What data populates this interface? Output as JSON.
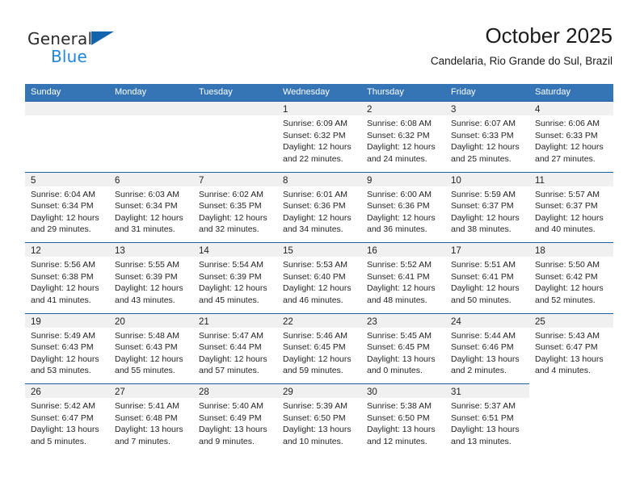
{
  "brand": {
    "name_part1": "General",
    "name_part2": "Blue",
    "triangle_icon": "triangle-icon",
    "accent_color": "#1264ac",
    "blue_text_color": "#2288dd"
  },
  "header": {
    "title": "October 2025",
    "subtitle": "Candelaria, Rio Grande do Sul, Brazil"
  },
  "theme": {
    "header_row_bg": "#3575b5",
    "cell_border": "#1f5fa0",
    "daynum_band_bg": "#f0f0f0"
  },
  "weekdays": [
    "Sunday",
    "Monday",
    "Tuesday",
    "Wednesday",
    "Thursday",
    "Friday",
    "Saturday"
  ],
  "weeks": [
    [
      {
        "blank": true
      },
      {
        "blank": true
      },
      {
        "blank": true
      },
      {
        "day": "1",
        "sunrise": "Sunrise: 6:09 AM",
        "sunset": "Sunset: 6:32 PM",
        "daylight_line1": "Daylight: 12 hours",
        "daylight_line2": "and 22 minutes."
      },
      {
        "day": "2",
        "sunrise": "Sunrise: 6:08 AM",
        "sunset": "Sunset: 6:32 PM",
        "daylight_line1": "Daylight: 12 hours",
        "daylight_line2": "and 24 minutes."
      },
      {
        "day": "3",
        "sunrise": "Sunrise: 6:07 AM",
        "sunset": "Sunset: 6:33 PM",
        "daylight_line1": "Daylight: 12 hours",
        "daylight_line2": "and 25 minutes."
      },
      {
        "day": "4",
        "sunrise": "Sunrise: 6:06 AM",
        "sunset": "Sunset: 6:33 PM",
        "daylight_line1": "Daylight: 12 hours",
        "daylight_line2": "and 27 minutes."
      }
    ],
    [
      {
        "day": "5",
        "sunrise": "Sunrise: 6:04 AM",
        "sunset": "Sunset: 6:34 PM",
        "daylight_line1": "Daylight: 12 hours",
        "daylight_line2": "and 29 minutes."
      },
      {
        "day": "6",
        "sunrise": "Sunrise: 6:03 AM",
        "sunset": "Sunset: 6:34 PM",
        "daylight_line1": "Daylight: 12 hours",
        "daylight_line2": "and 31 minutes."
      },
      {
        "day": "7",
        "sunrise": "Sunrise: 6:02 AM",
        "sunset": "Sunset: 6:35 PM",
        "daylight_line1": "Daylight: 12 hours",
        "daylight_line2": "and 32 minutes."
      },
      {
        "day": "8",
        "sunrise": "Sunrise: 6:01 AM",
        "sunset": "Sunset: 6:36 PM",
        "daylight_line1": "Daylight: 12 hours",
        "daylight_line2": "and 34 minutes."
      },
      {
        "day": "9",
        "sunrise": "Sunrise: 6:00 AM",
        "sunset": "Sunset: 6:36 PM",
        "daylight_line1": "Daylight: 12 hours",
        "daylight_line2": "and 36 minutes."
      },
      {
        "day": "10",
        "sunrise": "Sunrise: 5:59 AM",
        "sunset": "Sunset: 6:37 PM",
        "daylight_line1": "Daylight: 12 hours",
        "daylight_line2": "and 38 minutes."
      },
      {
        "day": "11",
        "sunrise": "Sunrise: 5:57 AM",
        "sunset": "Sunset: 6:37 PM",
        "daylight_line1": "Daylight: 12 hours",
        "daylight_line2": "and 40 minutes."
      }
    ],
    [
      {
        "day": "12",
        "sunrise": "Sunrise: 5:56 AM",
        "sunset": "Sunset: 6:38 PM",
        "daylight_line1": "Daylight: 12 hours",
        "daylight_line2": "and 41 minutes."
      },
      {
        "day": "13",
        "sunrise": "Sunrise: 5:55 AM",
        "sunset": "Sunset: 6:39 PM",
        "daylight_line1": "Daylight: 12 hours",
        "daylight_line2": "and 43 minutes."
      },
      {
        "day": "14",
        "sunrise": "Sunrise: 5:54 AM",
        "sunset": "Sunset: 6:39 PM",
        "daylight_line1": "Daylight: 12 hours",
        "daylight_line2": "and 45 minutes."
      },
      {
        "day": "15",
        "sunrise": "Sunrise: 5:53 AM",
        "sunset": "Sunset: 6:40 PM",
        "daylight_line1": "Daylight: 12 hours",
        "daylight_line2": "and 46 minutes."
      },
      {
        "day": "16",
        "sunrise": "Sunrise: 5:52 AM",
        "sunset": "Sunset: 6:41 PM",
        "daylight_line1": "Daylight: 12 hours",
        "daylight_line2": "and 48 minutes."
      },
      {
        "day": "17",
        "sunrise": "Sunrise: 5:51 AM",
        "sunset": "Sunset: 6:41 PM",
        "daylight_line1": "Daylight: 12 hours",
        "daylight_line2": "and 50 minutes."
      },
      {
        "day": "18",
        "sunrise": "Sunrise: 5:50 AM",
        "sunset": "Sunset: 6:42 PM",
        "daylight_line1": "Daylight: 12 hours",
        "daylight_line2": "and 52 minutes."
      }
    ],
    [
      {
        "day": "19",
        "sunrise": "Sunrise: 5:49 AM",
        "sunset": "Sunset: 6:43 PM",
        "daylight_line1": "Daylight: 12 hours",
        "daylight_line2": "and 53 minutes."
      },
      {
        "day": "20",
        "sunrise": "Sunrise: 5:48 AM",
        "sunset": "Sunset: 6:43 PM",
        "daylight_line1": "Daylight: 12 hours",
        "daylight_line2": "and 55 minutes."
      },
      {
        "day": "21",
        "sunrise": "Sunrise: 5:47 AM",
        "sunset": "Sunset: 6:44 PM",
        "daylight_line1": "Daylight: 12 hours",
        "daylight_line2": "and 57 minutes."
      },
      {
        "day": "22",
        "sunrise": "Sunrise: 5:46 AM",
        "sunset": "Sunset: 6:45 PM",
        "daylight_line1": "Daylight: 12 hours",
        "daylight_line2": "and 59 minutes."
      },
      {
        "day": "23",
        "sunrise": "Sunrise: 5:45 AM",
        "sunset": "Sunset: 6:45 PM",
        "daylight_line1": "Daylight: 13 hours",
        "daylight_line2": "and 0 minutes."
      },
      {
        "day": "24",
        "sunrise": "Sunrise: 5:44 AM",
        "sunset": "Sunset: 6:46 PM",
        "daylight_line1": "Daylight: 13 hours",
        "daylight_line2": "and 2 minutes."
      },
      {
        "day": "25",
        "sunrise": "Sunrise: 5:43 AM",
        "sunset": "Sunset: 6:47 PM",
        "daylight_line1": "Daylight: 13 hours",
        "daylight_line2": "and 4 minutes."
      }
    ],
    [
      {
        "day": "26",
        "sunrise": "Sunrise: 5:42 AM",
        "sunset": "Sunset: 6:47 PM",
        "daylight_line1": "Daylight: 13 hours",
        "daylight_line2": "and 5 minutes."
      },
      {
        "day": "27",
        "sunrise": "Sunrise: 5:41 AM",
        "sunset": "Sunset: 6:48 PM",
        "daylight_line1": "Daylight: 13 hours",
        "daylight_line2": "and 7 minutes."
      },
      {
        "day": "28",
        "sunrise": "Sunrise: 5:40 AM",
        "sunset": "Sunset: 6:49 PM",
        "daylight_line1": "Daylight: 13 hours",
        "daylight_line2": "and 9 minutes."
      },
      {
        "day": "29",
        "sunrise": "Sunrise: 5:39 AM",
        "sunset": "Sunset: 6:50 PM",
        "daylight_line1": "Daylight: 13 hours",
        "daylight_line2": "and 10 minutes."
      },
      {
        "day": "30",
        "sunrise": "Sunrise: 5:38 AM",
        "sunset": "Sunset: 6:50 PM",
        "daylight_line1": "Daylight: 13 hours",
        "daylight_line2": "and 12 minutes."
      },
      {
        "day": "31",
        "sunrise": "Sunrise: 5:37 AM",
        "sunset": "Sunset: 6:51 PM",
        "daylight_line1": "Daylight: 13 hours",
        "daylight_line2": "and 13 minutes."
      },
      {
        "trailing": true
      }
    ]
  ]
}
